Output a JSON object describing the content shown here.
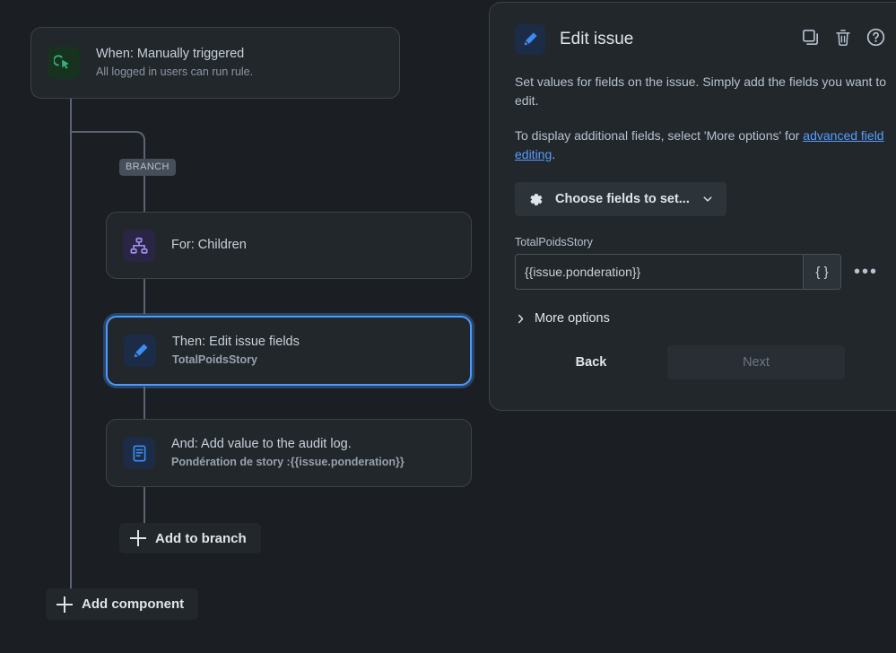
{
  "colors": {
    "background": "#1b1f24",
    "card_fill": "#22272b",
    "card_border": "#3a424b",
    "selected_border": "#4c9aff",
    "connector": "#5a6472",
    "link": "#579dff",
    "trigger_icon": "#36b37e",
    "branch_icon": "#9f8fef",
    "action_icon": "#3b8bf0"
  },
  "canvas": {
    "trigger": {
      "icon": "cursor-click-icon",
      "title": "When: Manually triggered",
      "subtitle": "All logged in users can run rule."
    },
    "branch_label": "BRANCH",
    "nodes": [
      {
        "icon": "hierarchy-icon",
        "title": "For: Children",
        "subtitle": "",
        "selected": false
      },
      {
        "icon": "pencil-icon",
        "title": "Then: Edit issue fields",
        "subtitle": "TotalPoidsStory",
        "selected": true
      },
      {
        "icon": "audit-log-icon",
        "title": "And: Add value to the audit log.",
        "subtitle": "Pondération de story :{{issue.ponderation}}",
        "selected": false
      }
    ],
    "add_to_branch_label": "Add to branch",
    "add_component_label": "Add component"
  },
  "panel": {
    "icon": "pencil-icon",
    "title": "Edit issue",
    "header_actions": [
      {
        "name": "duplicate-icon",
        "label": "Duplicate"
      },
      {
        "name": "trash-icon",
        "label": "Delete"
      },
      {
        "name": "help-icon",
        "label": "Help"
      }
    ],
    "description_1": "Set values for fields on the issue. Simply add the fields you want to edit.",
    "description_2_prefix": "To display additional fields, select 'More options' for ",
    "description_2_link": "advanced field editing",
    "description_2_suffix": ".",
    "choose_fields_label": "Choose fields to set...",
    "field": {
      "label": "TotalPoidsStory",
      "value": "{{issue.ponderation}}",
      "placeholder": "",
      "braces_label": "{ }",
      "more_label": "•••"
    },
    "more_options_label": "More options",
    "back_label": "Back",
    "next_label": "Next"
  }
}
